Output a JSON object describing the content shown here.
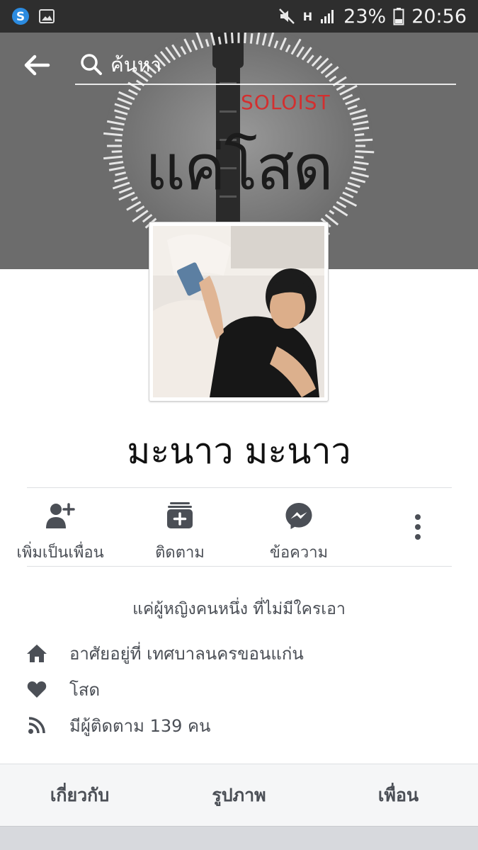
{
  "status_bar": {
    "battery": "23%",
    "time": "20:56",
    "network": "H",
    "icons": [
      "skype-icon",
      "gallery-icon",
      "mute-icon",
      "signal-icon",
      "battery-icon"
    ]
  },
  "header": {
    "search_placeholder": "ค้นหา",
    "back_icon": "back-arrow-icon",
    "search_icon": "search-icon"
  },
  "cover": {
    "logo_top": "SOLOIST",
    "logo_main": "แค่โสด"
  },
  "profile": {
    "name": "มะนาว มะนาว"
  },
  "actions": [
    {
      "label": "เพิ่มเป็นเพื่อน",
      "icon": "add-friend-icon"
    },
    {
      "label": "ติดตาม",
      "icon": "follow-icon"
    },
    {
      "label": "ข้อความ",
      "icon": "messenger-icon"
    }
  ],
  "more_icon": "more-vertical-icon",
  "bio": "แค่ผู้หญิงคนหนึ่ง ที่ไม่มีใครเอา",
  "info": [
    {
      "icon": "home-icon",
      "text": "อาศัยอยู่ที่ เทศบาลนครขอนแก่น"
    },
    {
      "icon": "heart-icon",
      "text": "โสด"
    },
    {
      "icon": "rss-icon",
      "text": "มีผู้ติดตาม 139 คน"
    }
  ],
  "tabs": [
    {
      "label": "เกี่ยวกับ"
    },
    {
      "label": "รูปภาพ"
    },
    {
      "label": "เพื่อน"
    }
  ],
  "colors": {
    "status_bar": "#2e2e2e",
    "icon_gray": "#4b4f56",
    "divider": "#dddfe2",
    "tab_bg": "#f5f6f7",
    "cover_accent": "#d32f2f"
  }
}
